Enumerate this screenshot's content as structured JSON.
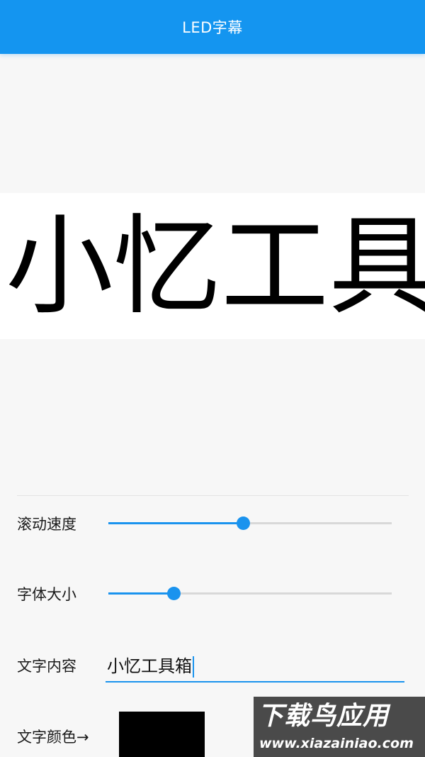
{
  "appbar": {
    "title": "LED字幕",
    "color": "#1495f0"
  },
  "display": {
    "text": "小忆工具",
    "text_color": "#000000",
    "background": "#ffffff"
  },
  "controls": {
    "speed": {
      "label": "滚动速度",
      "value_fraction": 0.475
    },
    "size": {
      "label": "字体大小",
      "value_fraction": 0.23
    },
    "content": {
      "label": "文字内容",
      "value": "小忆工具箱"
    },
    "color": {
      "label": "文字颜色→",
      "value": "#000000"
    }
  },
  "watermark": {
    "title": "下载鸟应用",
    "url": "www.xiazainiao.com"
  },
  "accent_color": "#1a93ee"
}
